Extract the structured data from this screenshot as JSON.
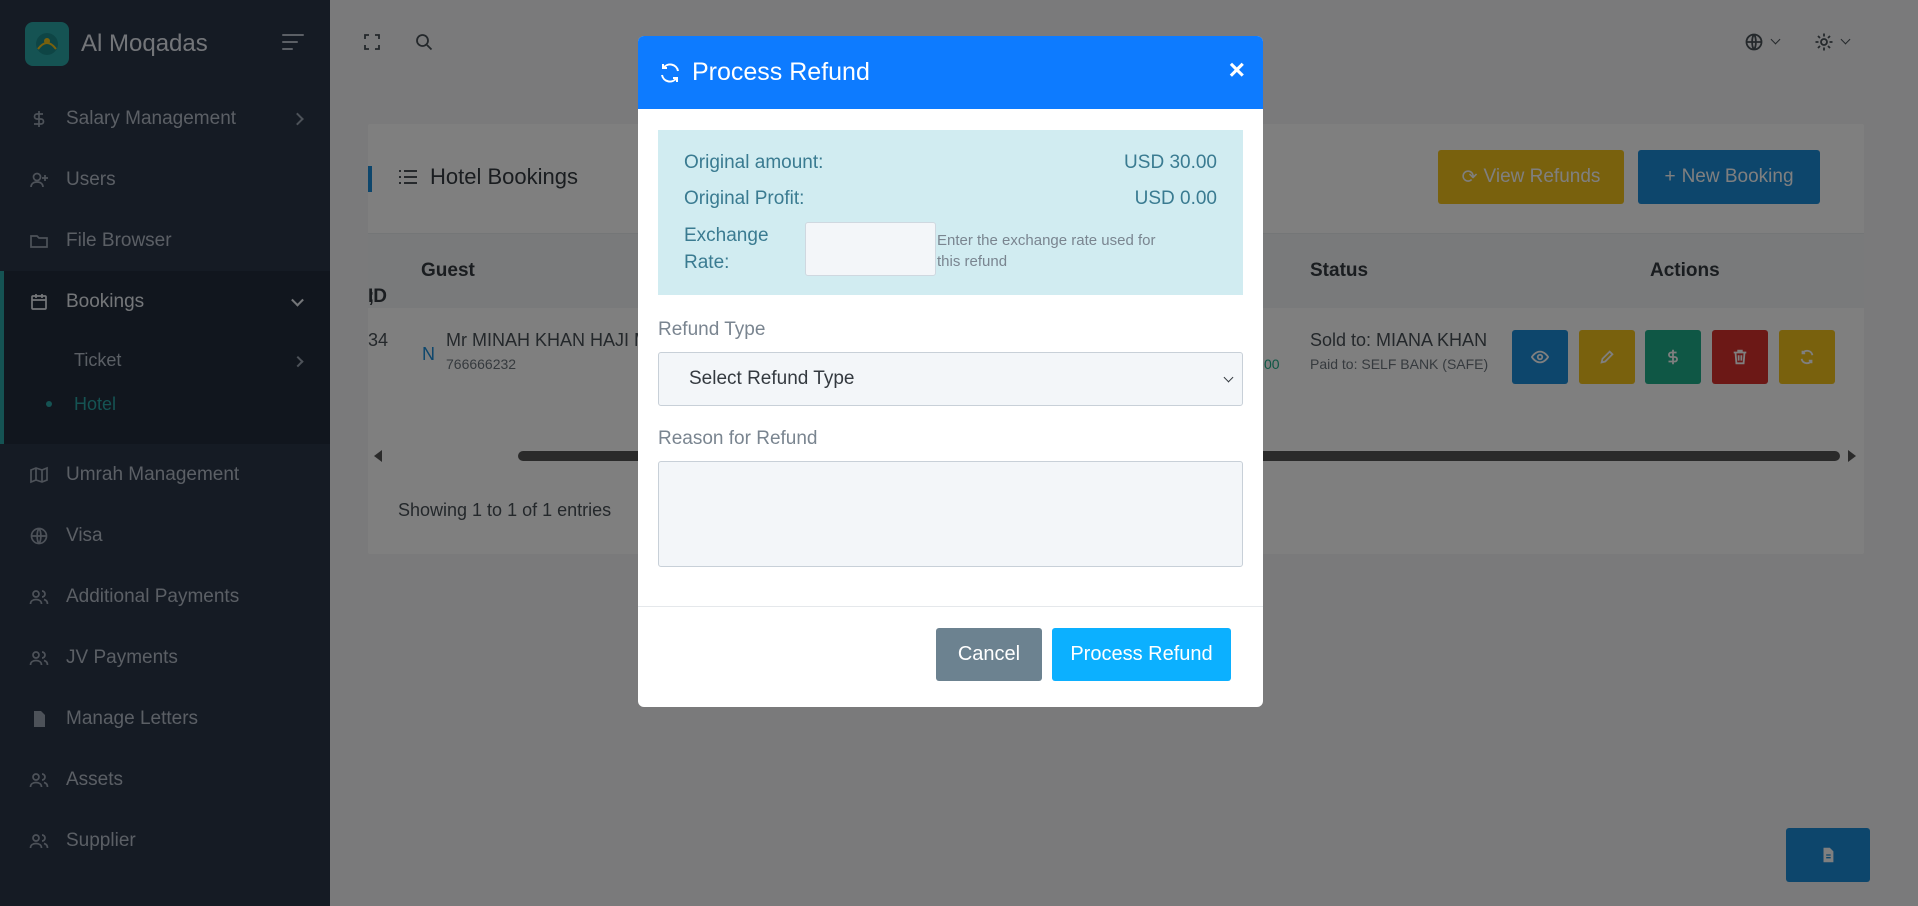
{
  "brand": {
    "name": "Al Moqadas"
  },
  "sidebar": {
    "items": [
      {
        "label": "Salary Management",
        "icon": "dollar-icon"
      },
      {
        "label": "Users",
        "icon": "user-plus-icon"
      },
      {
        "label": "File Browser",
        "icon": "folder-icon"
      },
      {
        "label": "Bookings",
        "icon": "calendar-icon"
      },
      {
        "label": "Umrah Management",
        "icon": "map-icon"
      },
      {
        "label": "Visa",
        "icon": "globe-icon"
      },
      {
        "label": "Additional Payments",
        "icon": "users-icon"
      },
      {
        "label": "JV Payments",
        "icon": "users-icon"
      },
      {
        "label": "Manage Letters",
        "icon": "file-icon"
      },
      {
        "label": "Assets",
        "icon": "users-icon"
      },
      {
        "label": "Supplier",
        "icon": "users-icon"
      }
    ],
    "sub_items": [
      {
        "label": "Ticket"
      },
      {
        "label": "Hotel"
      }
    ]
  },
  "card": {
    "title": "Hotel Bookings",
    "view_refunds_label": "View Refunds",
    "new_booking_label": "New Booking",
    "columns": {
      "id": "ID",
      "guest": "Guest",
      "status": "Status",
      "actions": "Actions"
    },
    "row": {
      "id_fragment": "34",
      "badge": "N",
      "guest_name": "Mr MINAH KHAN HAJI M",
      "guest_phone": "766666232",
      "amount_fragment": "00",
      "sold_to": "Sold to: MIANA KHAN",
      "paid_to": "Paid to: SELF BANK (SAFE)"
    },
    "showing": "Showing 1 to 1 of 1 entries"
  },
  "modal": {
    "title": "Process Refund",
    "close": "×",
    "original_amount_label": "Original amount:",
    "original_amount_value": "USD 30.00",
    "original_profit_label": "Original Profit:",
    "original_profit_value": "USD 0.00",
    "exchange_rate_label": "Exchange Rate:",
    "exchange_rate_value": "",
    "exchange_rate_help": "Enter the exchange rate used for this refund",
    "refund_type_label": "Refund Type",
    "refund_type_selected": "Select Refund Type",
    "reason_label": "Reason for Refund",
    "reason_value": "",
    "cancel_label": "Cancel",
    "process_label": "Process Refund"
  },
  "colors": {
    "sidebar_bg": "#2b3648",
    "accent": "#2aa7a7",
    "primary": "#0d7bff",
    "info_bg": "#d1ecf1",
    "warning": "#f2c21b",
    "success": "#1fae8a",
    "danger": "#d9302c",
    "secondary": "#6c8290"
  }
}
